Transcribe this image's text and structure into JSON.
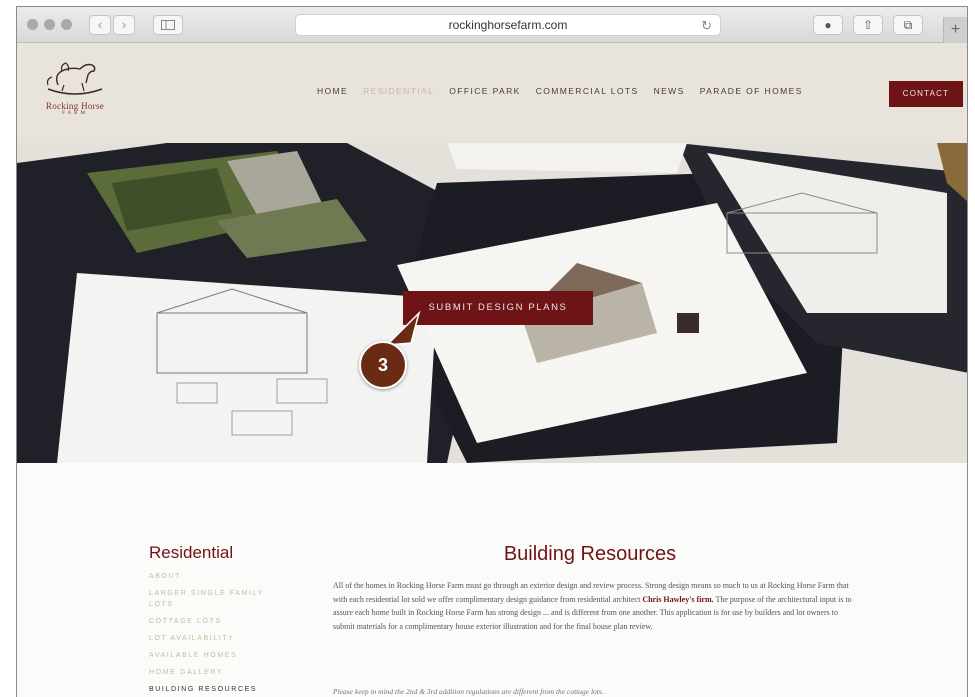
{
  "browser": {
    "url": "rockinghorsefarm.com",
    "back_icon": "chevron-left-icon",
    "forward_icon": "chevron-right-icon",
    "sidebar_icon": "sidebar-icon",
    "reload_icon": "reload-icon",
    "download_icon": "download-icon",
    "share_icon": "share-icon",
    "tabs_icon": "tabs-icon",
    "new_tab_icon": "plus-icon"
  },
  "site": {
    "logo_name": "Rocking Horse",
    "logo_sub": "FARM",
    "nav": [
      "HOME",
      "RESIDENTIAL",
      "OFFICE PARK",
      "COMMERCIAL LOTS",
      "NEWS",
      "PARADE OF HOMES"
    ],
    "active_nav": "RESIDENTIAL",
    "contact": "CONTACT",
    "brand_color": "#6e1416"
  },
  "hero": {
    "button": "SUBMIT DESIGN PLANS",
    "step_badge": "3"
  },
  "sidebar": {
    "title": "Residential",
    "items": [
      "ABOUT",
      "LARGER SINGLE FAMILY LOTS",
      "COTTAGE LOTS",
      "LOT AVAILABILITY",
      "AVAILABLE HOMES",
      "HOME GALLERY",
      "BUILDING RESOURCES"
    ],
    "current": "BUILDING RESOURCES"
  },
  "main": {
    "title": "Building Resources",
    "para_1": "All of the homes in Rocking Horse Farm must go through an exterior design and review process. Strong design means so much to us at Rocking Horse Farm that with each residential lot sold we offer complimentary design guidance from residential architect ",
    "para_link": "Chris Hawley's firm.",
    "para_2": " The purpose of the architectural input is to assure each home built in Rocking Horse Farm has strong design ... and is different from one another. This application is for use by builders and lot owners to submit materials for a complimentary house exterior illustration and for the final house plan review.",
    "note": "Please keep in mind the 2nd & 3rd addition regulations are different from the cottage lots."
  }
}
